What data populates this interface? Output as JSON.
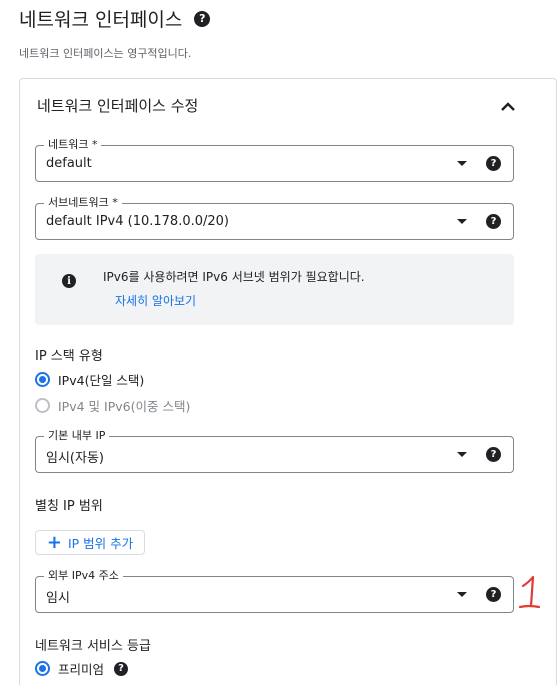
{
  "header": {
    "title": "네트워크 인터페이스",
    "description": "네트워크 인터페이스는 영구적입니다."
  },
  "card": {
    "title": "네트워크 인터페이스 수정",
    "network": {
      "label": "네트워크 *",
      "value": "default"
    },
    "subnetwork": {
      "label": "서브네트워크 *",
      "value": "default IPv4 (10.178.0.0/20)"
    },
    "info": {
      "text": "IPv6를 사용하려면 IPv6 서브넷 범위가 필요합니다.",
      "link": "자세히 알아보기"
    },
    "ip_stack": {
      "title": "IP 스택 유형",
      "options": [
        {
          "label": "IPv4(단일 스택)",
          "selected": true,
          "enabled": true
        },
        {
          "label": "IPv4 및 IPv6(이중 스택)",
          "selected": false,
          "enabled": false
        }
      ]
    },
    "internal_ip": {
      "label": "기본 내부 IP",
      "value": "임시(자동)"
    },
    "alias": {
      "title": "별칭 IP 범위",
      "add_button": "IP 범위 추가"
    },
    "external_ip": {
      "label": "외부 IPv4 주소",
      "value": "임시"
    },
    "annotation": "1",
    "service_tier": {
      "title": "네트워크 서비스 등급",
      "option": "프리미엄"
    }
  },
  "colors": {
    "accent": "#1a73e8",
    "annotation": "#e53935"
  },
  "icons": [
    "help-icon",
    "chevron-up-icon",
    "dropdown-arrow-icon",
    "info-icon",
    "plus-icon",
    "radio-icon"
  ]
}
